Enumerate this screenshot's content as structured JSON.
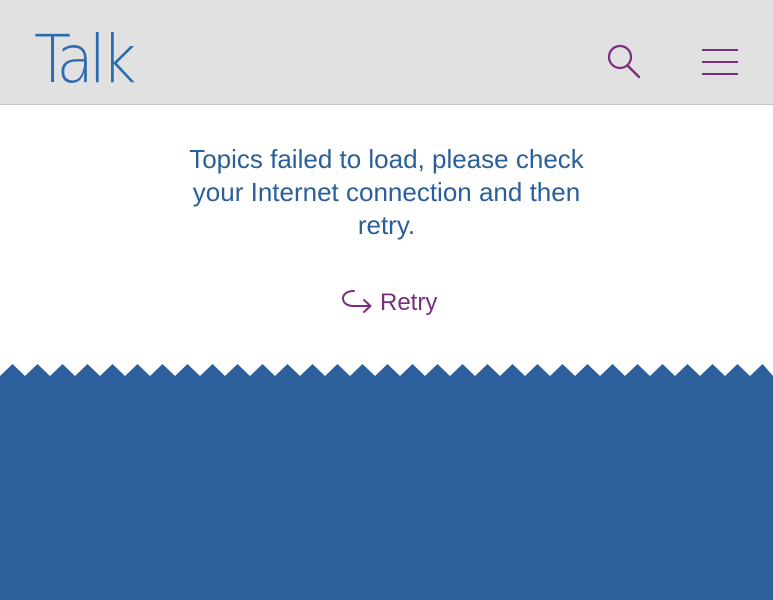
{
  "app": {
    "logo_text": "Talk"
  },
  "header": {
    "search_icon": "search-icon",
    "menu_icon": "hamburger-menu-icon"
  },
  "error": {
    "message": "Topics failed to load, please check your Internet connection and then retry.",
    "retry_label": "Retry",
    "retry_icon": "retry-arrow-icon"
  },
  "colors": {
    "header_bg": "#e1e1e1",
    "brand_blue": "#2d6bb0",
    "accent_purple": "#7a2d7f",
    "footer_blue": "#2c5f9b"
  }
}
